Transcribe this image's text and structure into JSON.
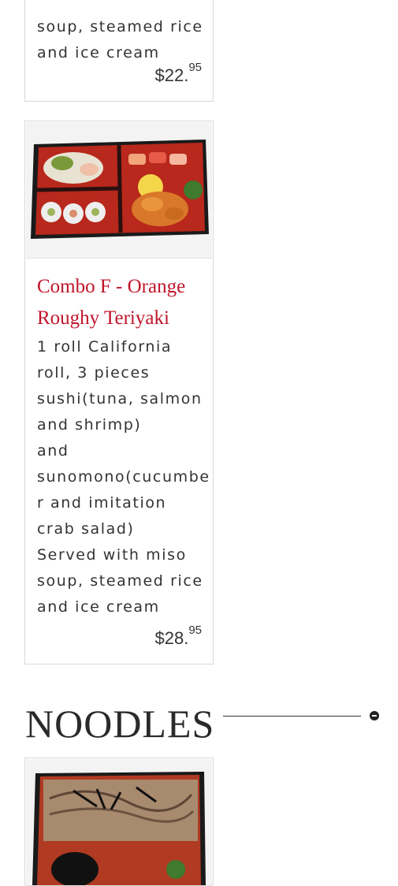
{
  "menu_item_top": {
    "description_lines": [
      "soup, steamed rice",
      "and ice cream"
    ],
    "price_dollars": "$22.",
    "price_cents": "95"
  },
  "menu_item_combo_f": {
    "title": "Combo F - Orange Roughy Teriyaki",
    "image_alt": "bento-box-photo",
    "description_lines": [
      "1 roll California",
      "roll, 3 pieces",
      "sushi(tuna, salmon",
      "and shrimp)",
      "and",
      "sunomono(cucumbe",
      "r and imitation",
      "crab salad)",
      "Served with miso",
      "soup, steamed rice",
      "and ice cream"
    ],
    "price_dollars": "$28.",
    "price_cents": "95"
  },
  "section_noodles": {
    "title": "NOODLES",
    "collapse_icon": "minus-circle-icon"
  },
  "menu_item_noodles_first": {
    "image_alt": "soba-noodle-bento-photo"
  }
}
